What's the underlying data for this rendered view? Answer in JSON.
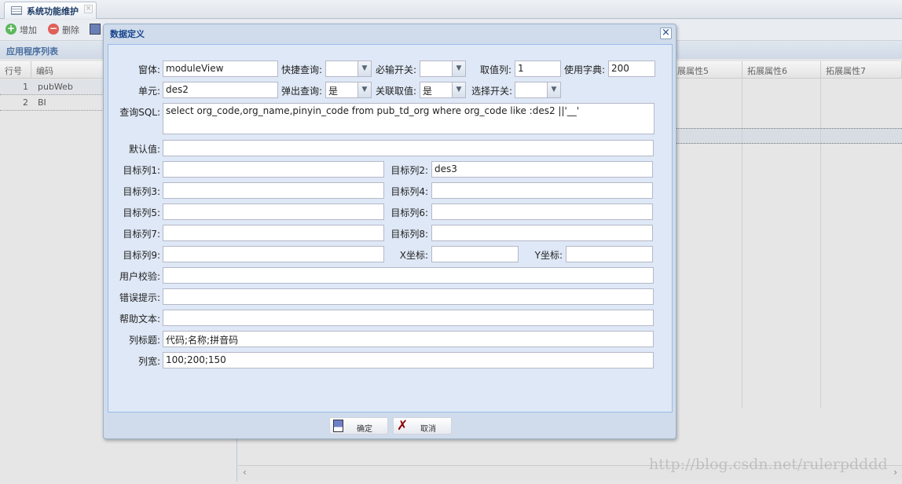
{
  "tab": {
    "title": "系统功能维护"
  },
  "toolbar": {
    "add": "增加",
    "delete": "删除"
  },
  "left_panel": {
    "title": "应用程序列表",
    "columns": [
      "行号",
      "编码"
    ],
    "rows": [
      {
        "no": "1",
        "code": "pubWeb"
      },
      {
        "no": "2",
        "code": "BI"
      }
    ]
  },
  "right_grid": {
    "columns": [
      "拓展属性5",
      "拓展属性6",
      "拓展属性7"
    ]
  },
  "watermark": "http://blog.csdn.net/rulerpdddd",
  "dialog": {
    "title": "数据定义",
    "fields": {
      "form": {
        "label": "窗体:",
        "value": "moduleView"
      },
      "quick_query": {
        "label": "快捷查询:",
        "value": ""
      },
      "required": {
        "label": "必输开关:",
        "value": ""
      },
      "value_col": {
        "label": "取值列:",
        "value": "1"
      },
      "dictionary": {
        "label": "使用字典:",
        "value": "200"
      },
      "unit": {
        "label": "单元:",
        "value": "des2"
      },
      "popup_query": {
        "label": "弹出查询:",
        "value": "是"
      },
      "linked_value": {
        "label": "关联取值:",
        "value": "是"
      },
      "select_switch": {
        "label": "选择开关:",
        "value": ""
      },
      "sql": {
        "label": "查询SQL:",
        "value": "select org_code,org_name,pinyin_code from pub_td_org where  org_code like  :des2 ||'__'"
      },
      "default": {
        "label": "默认值:",
        "value": ""
      },
      "target1": {
        "label": "目标列1:",
        "value": ""
      },
      "target2": {
        "label": "目标列2:",
        "value": "des3"
      },
      "target3": {
        "label": "目标列3:",
        "value": ""
      },
      "target4": {
        "label": "目标列4:",
        "value": ""
      },
      "target5": {
        "label": "目标列5:",
        "value": ""
      },
      "target6": {
        "label": "目标列6:",
        "value": ""
      },
      "target7": {
        "label": "目标列7:",
        "value": ""
      },
      "target8": {
        "label": "目标列8:",
        "value": ""
      },
      "target9": {
        "label": "目标列9:",
        "value": ""
      },
      "x": {
        "label": "X坐标:",
        "value": ""
      },
      "y": {
        "label": "Y坐标:",
        "value": ""
      },
      "validation": {
        "label": "用户校验:",
        "value": ""
      },
      "error": {
        "label": "错误提示:",
        "value": ""
      },
      "help": {
        "label": "帮助文本:",
        "value": ""
      },
      "col_titles": {
        "label": "列标题:",
        "value": "代码;名称;拼音码"
      },
      "col_widths": {
        "label": "列宽:",
        "value": "100;200;150"
      }
    },
    "ok": "确定",
    "cancel": "取消"
  }
}
